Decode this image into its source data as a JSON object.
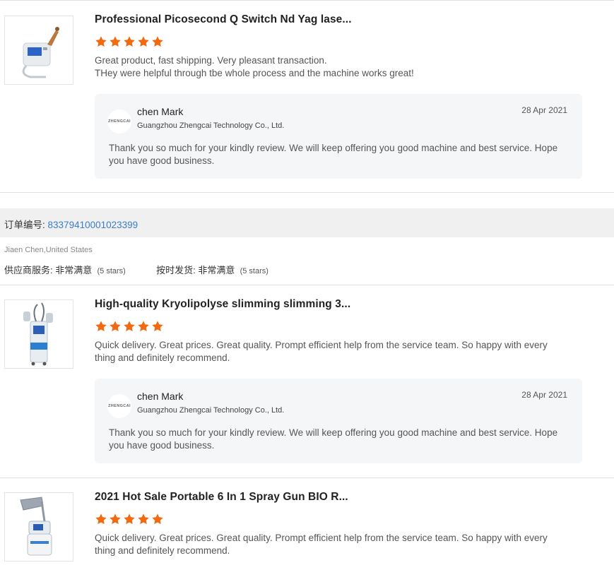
{
  "reviews": [
    {
      "product_title": "Professional Picosecond Q Switch Nd Yag lase...",
      "rating": 5,
      "review_lines": [
        "Great product, fast shipping.  Very pleasant transaction.",
        "THey were helpful through tbe whole process and the machine works great!"
      ],
      "reply": {
        "logo_text": "ZHENGCAI",
        "name": "chen Mark",
        "company": "Guangzhou Zhengcai Technology Co., Ltd.",
        "date": "28 Apr 2021",
        "message": "Thank you so much for your kindly review. We will keep offering you good machine and best service. Hope you have good business."
      }
    },
    {
      "product_title": "High-quality Kryolipolyse slimming slimming 3...",
      "rating": 5,
      "review_lines": [
        "Quick delivery. Great prices. Great quality. Prompt efficient help from the service team. So happy with every thing and definitely recommend."
      ],
      "reply": {
        "logo_text": "ZHENGCAI",
        "name": "chen Mark",
        "company": "Guangzhou Zhengcai Technology Co., Ltd.",
        "date": "28 Apr 2021",
        "message": "Thank you so much for your kindly review. We will keep offering you good machine and best service. Hope you have good business."
      }
    },
    {
      "product_title": "2021 Hot Sale Portable 6 In 1 Spray Gun BIO R...",
      "rating": 5,
      "review_lines": [
        "Quick delivery. Great prices. Great quality. Prompt efficient help from the service team. So happy with every thing and definitely recommend."
      ]
    }
  ],
  "order": {
    "label": "订单编号:",
    "number": "83379410001023399",
    "buyer": "Jiaen Chen,United States",
    "supplier_service_label": "供应商服务:",
    "supplier_service_value": "非常满意",
    "supplier_service_stars": "(5 stars)",
    "on_time_label": "按时发货:",
    "on_time_value": "非常满意",
    "on_time_stars": "(5 stars)"
  },
  "colors": {
    "star": "#f26a10",
    "link": "#3a7dc9",
    "reply_bg": "#f5f6f8"
  },
  "icons": {
    "star": "star-icon",
    "logo": "company-logo"
  }
}
